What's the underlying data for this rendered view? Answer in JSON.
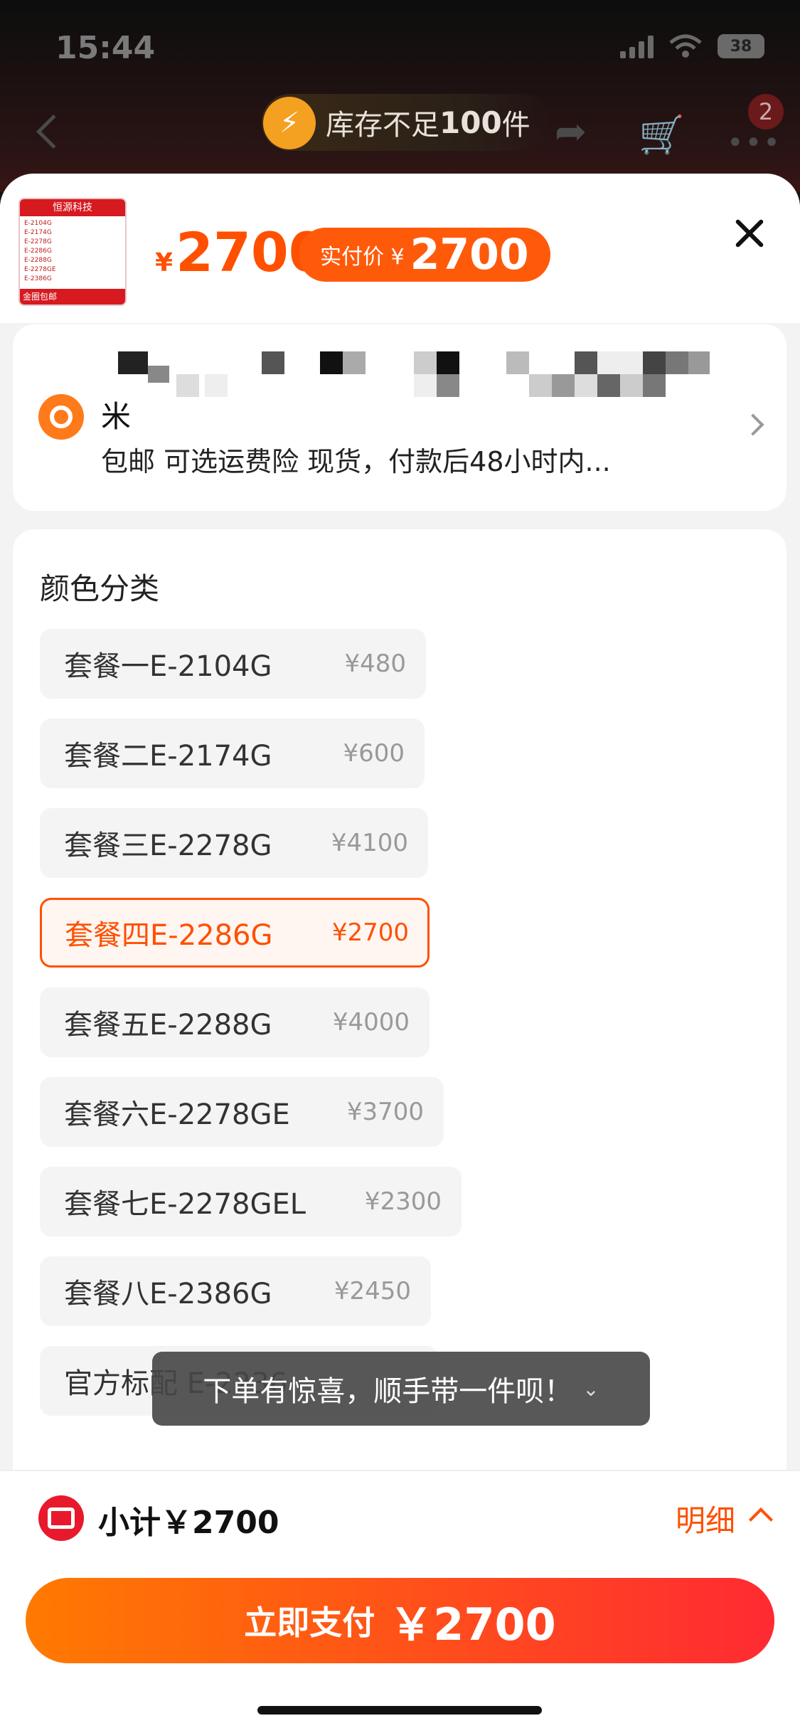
{
  "status": {
    "time": "15:44",
    "battery": "38"
  },
  "nav": {
    "stock_text": "库存不足",
    "stock_count": "100",
    "stock_unit": "件",
    "cart_badge": "2"
  },
  "product": {
    "price_symbol": "¥",
    "price": "2700",
    "actual_label": "实付价 ¥",
    "actual_price": "2700",
    "thumb_header": "恒源科技",
    "thumb_footer": "金圈包邮"
  },
  "address": {
    "line_visible": "米",
    "shipping": "包邮  可选运费险  现货，付款后48小时内..."
  },
  "sku": {
    "title": "颜色分类",
    "options": [
      {
        "name": "套餐一E-2104G",
        "price": "¥480"
      },
      {
        "name": "套餐二E-2174G",
        "price": "¥600"
      },
      {
        "name": "套餐三E-2278G",
        "price": "¥4100"
      },
      {
        "name": "套餐四E-2286G",
        "price": "¥2700",
        "selected": true
      },
      {
        "name": "套餐五E-2288G",
        "price": "¥4000"
      },
      {
        "name": "套餐六E-2278GE",
        "price": "¥3700"
      },
      {
        "name": "套餐七E-2278GEL",
        "price": "¥2300"
      },
      {
        "name": "套餐八E-2386G",
        "price": "¥2450"
      },
      {
        "name": "官方标配 E-2236",
        "price": ""
      }
    ]
  },
  "toast": {
    "text": "下单有惊喜，顺手带一件呗！"
  },
  "bottom": {
    "subtotal": "小计￥2700",
    "detail": "明细",
    "pay_label": "立即支付",
    "pay_amount": "￥2700"
  },
  "colors": {
    "accent": "#ff5000",
    "pay_start": "#ff7a00",
    "pay_end": "#ff2a32"
  }
}
